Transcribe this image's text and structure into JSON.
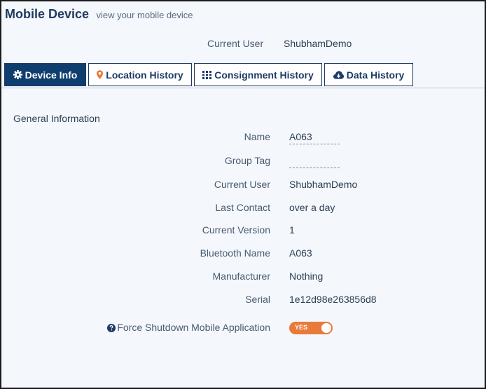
{
  "header": {
    "title": "Mobile Device",
    "subtitle": "view your mobile device"
  },
  "current_user": {
    "label": "Current User",
    "value": "ShubhamDemo"
  },
  "tabs": [
    {
      "label": "Device Info",
      "icon": "gear-icon",
      "active": true
    },
    {
      "label": "Location History",
      "icon": "map-pin-icon",
      "active": false
    },
    {
      "label": "Consignment History",
      "icon": "grid-icon",
      "active": false
    },
    {
      "label": "Data History",
      "icon": "cloud-download-icon",
      "active": false
    }
  ],
  "general": {
    "title": "General Information",
    "fields": [
      {
        "label": "Name",
        "value": "A063"
      },
      {
        "label": "Group Tag",
        "value": ""
      },
      {
        "label": "Current User",
        "value": "ShubhamDemo"
      },
      {
        "label": "Last Contact",
        "value": "over a day"
      },
      {
        "label": "Current Version",
        "value": "1"
      },
      {
        "label": "Bluetooth Name",
        "value": "A063"
      },
      {
        "label": "Manufacturer",
        "value": "Nothing"
      },
      {
        "label": "Serial",
        "value": "1e12d98e263856d8"
      }
    ],
    "force_shutdown": {
      "label": "Force Shutdown Mobile Application",
      "toggle_text": "YES",
      "enabled": true
    }
  },
  "colors": {
    "primary": "#0f3d6e",
    "toggle_on": "#e87b3a",
    "pin_icon": "#e87b3a",
    "background": "#f4f7fc"
  }
}
